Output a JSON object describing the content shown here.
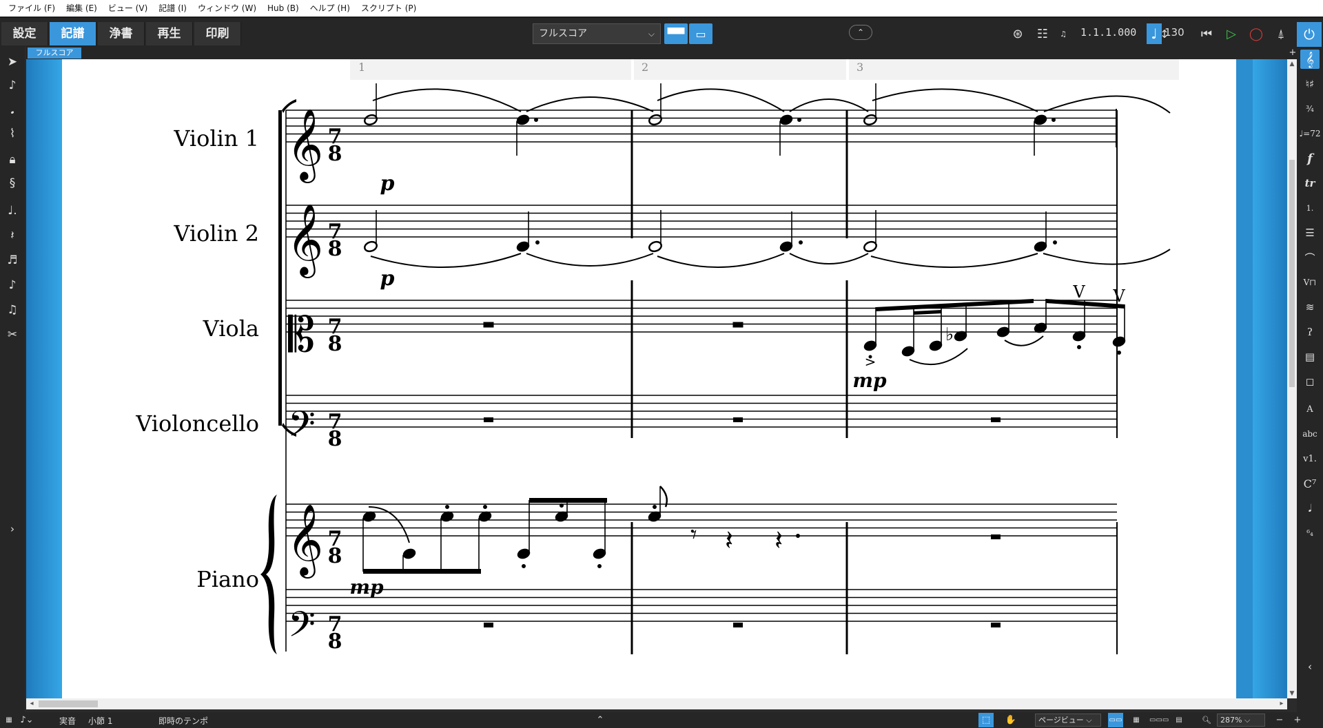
{
  "menu": [
    "ファイル (F)",
    "編集 (E)",
    "ビュー (V)",
    "記譜 (I)",
    "ウィンドウ (W)",
    "Hub (B)",
    "ヘルプ (H)",
    "スクリプト (P)"
  ],
  "modes": [
    "設定",
    "記譜",
    "浄書",
    "再生",
    "印刷"
  ],
  "active_mode": "記譜",
  "layout_select": {
    "value": "フルスコア"
  },
  "transport": {
    "position": "1.1.1.000",
    "tempo": "130"
  },
  "document_tab": "フルスコア",
  "colors": {
    "accent": "#3b97dc",
    "toolbar": "#262626",
    "page": "#ffffff"
  },
  "score": {
    "bar_numbers": [
      "1",
      "2",
      "3"
    ],
    "time_signature": {
      "numerator": "7",
      "denominator": "8"
    },
    "instruments": [
      "Violin 1",
      "Violin 2",
      "Viola",
      "Violoncello",
      "Piano"
    ],
    "dynamics": {
      "violin1_bar1": "p",
      "violin2_bar1": "p",
      "viola_bar3": "mp",
      "piano_bar1": "mp"
    },
    "viola_bowings": [
      "V",
      "V"
    ]
  },
  "left_palette_icons": [
    "select-arrow-icon",
    "insert-note-icon",
    "stem-icon",
    "tie-icon",
    "lock-icon",
    "clef-tool-icon",
    "dotted-note-icon",
    "rest-tool-icon",
    "tuplet-icon",
    "eighth-note-icon",
    "grace-note-icon",
    "scissors-icon"
  ],
  "right_palette_icons": [
    "clef-icon",
    "key-signature-icon",
    "time-signature-icon",
    "tempo-icon",
    "dynamics-icon",
    "ornament-icon",
    "repeat-ending-icon",
    "bar-icon",
    "holds-pauses-icon",
    "playing-techniques-icon",
    "tremolo-icon",
    "ear-icon",
    "cue-icon",
    "comment-icon",
    "text-icon",
    "lyrics-icon",
    "rehearsal-icon",
    "chord-symbol-icon",
    "note-head-icon",
    "figured-bass-icon"
  ],
  "status": {
    "pitch_mode": "実音",
    "bar": "小節 1",
    "tempo_mode": "即時のテンポ",
    "view": "ページビュー",
    "zoom": "287%"
  }
}
